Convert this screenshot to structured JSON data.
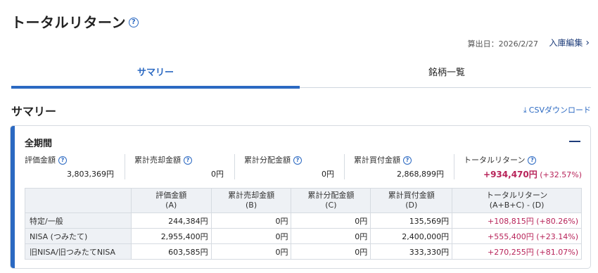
{
  "page": {
    "title": "トータルリターン",
    "help_icon": "question-circle-icon"
  },
  "meta": {
    "calc_date": "算出日：2026/2/27",
    "edit_link": "入庫編集"
  },
  "tabs": [
    {
      "label": "サマリー",
      "active": true
    },
    {
      "label": "銘柄一覧",
      "active": false
    }
  ],
  "summary": {
    "heading": "サマリー",
    "csv_label": "CSVダウンロード"
  },
  "card": {
    "period": "全期間",
    "metrics": [
      {
        "label": "評価金額",
        "value": "3,803,369円"
      },
      {
        "label": "累計売却金額",
        "value": "0円"
      },
      {
        "label": "累計分配金額",
        "value": "0円"
      },
      {
        "label": "累計買付金額",
        "value": "2,868,899円"
      },
      {
        "label": "トータルリターン",
        "value": "+934,470円",
        "pct": "(+32.57%)"
      }
    ],
    "table": {
      "headers": [
        {
          "line1": "評価金額",
          "line2": "(A)"
        },
        {
          "line1": "累計売却金額",
          "line2": "(B)"
        },
        {
          "line1": "累計分配金額",
          "line2": "(C)"
        },
        {
          "line1": "累計買付金額",
          "line2": "(D)"
        },
        {
          "line1": "トータルリターン",
          "line2": "(A+B+C) - (D)"
        }
      ],
      "rows": [
        {
          "label": "特定/一般",
          "a": "244,384円",
          "b": "0円",
          "c": "0円",
          "d": "135,569円",
          "tr": "+108,815円 (+80.26%)"
        },
        {
          "label": "NISA (つみたて)",
          "a": "2,955,400円",
          "b": "0円",
          "c": "0円",
          "d": "2,400,000円",
          "tr": "+555,400円 (+23.14%)"
        },
        {
          "label": "旧NISA/旧つみたてNISA",
          "a": "603,585円",
          "b": "0円",
          "c": "0円",
          "d": "333,330円",
          "tr": "+270,255円 (+81.07%)"
        }
      ]
    }
  },
  "colors": {
    "accent": "#2b69c2",
    "positive": "#b8245a",
    "header_bg": "#eef1f5"
  }
}
